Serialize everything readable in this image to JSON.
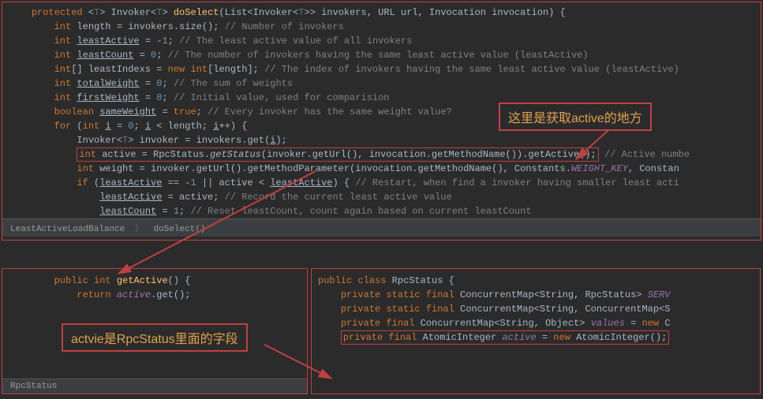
{
  "top": {
    "lines": [
      {
        "indent": 1,
        "segs": [
          {
            "t": "protected ",
            "c": "kw"
          },
          {
            "t": "<",
            "c": ""
          },
          {
            "t": "T",
            "c": "generic"
          },
          {
            "t": "> Invoker<",
            "c": ""
          },
          {
            "t": "T",
            "c": "generic"
          },
          {
            "t": "> ",
            "c": ""
          },
          {
            "t": "doSelect",
            "c": "method"
          },
          {
            "t": "(List<Invoker<",
            "c": ""
          },
          {
            "t": "T",
            "c": "generic"
          },
          {
            "t": ">> invokers, URL url, Invocation invocation) {",
            "c": ""
          }
        ]
      },
      {
        "indent": 2,
        "segs": [
          {
            "t": "int",
            "c": "kw"
          },
          {
            "t": " length = invokers.size(); ",
            "c": ""
          },
          {
            "t": "// Number of invokers",
            "c": "comment"
          }
        ]
      },
      {
        "indent": 2,
        "segs": [
          {
            "t": "int",
            "c": "kw"
          },
          {
            "t": " ",
            "c": ""
          },
          {
            "t": "leastActive",
            "c": "underline"
          },
          {
            "t": " = -",
            "c": ""
          },
          {
            "t": "1",
            "c": "num"
          },
          {
            "t": "; ",
            "c": ""
          },
          {
            "t": "// The least active value of all invokers",
            "c": "comment"
          }
        ]
      },
      {
        "indent": 2,
        "segs": [
          {
            "t": "int",
            "c": "kw"
          },
          {
            "t": " ",
            "c": ""
          },
          {
            "t": "leastCount",
            "c": "underline"
          },
          {
            "t": " = ",
            "c": ""
          },
          {
            "t": "0",
            "c": "num"
          },
          {
            "t": "; ",
            "c": ""
          },
          {
            "t": "// The number of invokers having the same least active value (leastActive)",
            "c": "comment"
          }
        ]
      },
      {
        "indent": 2,
        "segs": [
          {
            "t": "int",
            "c": "kw"
          },
          {
            "t": "[] leastIndexs = ",
            "c": ""
          },
          {
            "t": "new int",
            "c": "kw"
          },
          {
            "t": "[length]; ",
            "c": ""
          },
          {
            "t": "// The index of invokers having the same least active value (leastActive)",
            "c": "comment"
          }
        ]
      },
      {
        "indent": 2,
        "segs": [
          {
            "t": "int",
            "c": "kw"
          },
          {
            "t": " ",
            "c": ""
          },
          {
            "t": "totalWeight",
            "c": "underline"
          },
          {
            "t": " = ",
            "c": ""
          },
          {
            "t": "0",
            "c": "num"
          },
          {
            "t": "; ",
            "c": ""
          },
          {
            "t": "// The sum of weights",
            "c": "comment"
          }
        ]
      },
      {
        "indent": 2,
        "segs": [
          {
            "t": "int",
            "c": "kw"
          },
          {
            "t": " ",
            "c": ""
          },
          {
            "t": "firstWeight",
            "c": "underline"
          },
          {
            "t": " = ",
            "c": ""
          },
          {
            "t": "0",
            "c": "num"
          },
          {
            "t": "; ",
            "c": ""
          },
          {
            "t": "// Initial value, used for comparision",
            "c": "comment"
          }
        ]
      },
      {
        "indent": 2,
        "segs": [
          {
            "t": "boolean",
            "c": "kw"
          },
          {
            "t": " ",
            "c": ""
          },
          {
            "t": "sameWeight",
            "c": "underline"
          },
          {
            "t": " = ",
            "c": ""
          },
          {
            "t": "true",
            "c": "kw"
          },
          {
            "t": "; ",
            "c": ""
          },
          {
            "t": "// Every invoker has the same weight value?",
            "c": "comment"
          }
        ]
      },
      {
        "indent": 2,
        "segs": [
          {
            "t": "for ",
            "c": "kw"
          },
          {
            "t": "(",
            "c": ""
          },
          {
            "t": "int",
            "c": "kw"
          },
          {
            "t": " ",
            "c": ""
          },
          {
            "t": "i",
            "c": "underline"
          },
          {
            "t": " = ",
            "c": ""
          },
          {
            "t": "0",
            "c": "num"
          },
          {
            "t": "; ",
            "c": ""
          },
          {
            "t": "i",
            "c": "underline"
          },
          {
            "t": " < length; ",
            "c": ""
          },
          {
            "t": "i",
            "c": "underline"
          },
          {
            "t": "++) {",
            "c": ""
          }
        ]
      },
      {
        "indent": 3,
        "segs": [
          {
            "t": "Invoker<",
            "c": ""
          },
          {
            "t": "T",
            "c": "generic"
          },
          {
            "t": "> invoker = invokers.get(",
            "c": ""
          },
          {
            "t": "i",
            "c": "underline"
          },
          {
            "t": ");",
            "c": ""
          }
        ]
      },
      {
        "indent": 3,
        "boxed": true,
        "segs": [
          {
            "t": "int",
            "c": "kw"
          },
          {
            "t": " active = RpcStatus.",
            "c": ""
          },
          {
            "t": "getStatus",
            "c": "ital"
          },
          {
            "t": "(invoker.getUrl(), invocation.getMethodName()).getActive();",
            "c": ""
          }
        ],
        "tail": [
          {
            "t": " // Active numbe",
            "c": "comment"
          }
        ]
      },
      {
        "indent": 3,
        "segs": [
          {
            "t": "int",
            "c": "kw"
          },
          {
            "t": " weight = invoker.getUrl().getMethodParameter(invocation.getMethodName(), Constants.",
            "c": ""
          },
          {
            "t": "WEIGHT_KEY",
            "c": "field"
          },
          {
            "t": ", Constan",
            "c": ""
          }
        ]
      },
      {
        "indent": 3,
        "segs": [
          {
            "t": "if ",
            "c": "kw"
          },
          {
            "t": "(",
            "c": ""
          },
          {
            "t": "leastActive",
            "c": "underline"
          },
          {
            "t": " == -",
            "c": ""
          },
          {
            "t": "1",
            "c": "num"
          },
          {
            "t": " || active < ",
            "c": ""
          },
          {
            "t": "leastActive",
            "c": "underline"
          },
          {
            "t": ") { ",
            "c": ""
          },
          {
            "t": "// Restart, when find a invoker having smaller least acti",
            "c": "comment"
          }
        ]
      },
      {
        "indent": 4,
        "segs": [
          {
            "t": "leastActive",
            "c": "underline"
          },
          {
            "t": " = active; ",
            "c": ""
          },
          {
            "t": "// Record the current least active value",
            "c": "comment"
          }
        ]
      },
      {
        "indent": 4,
        "segs": [
          {
            "t": "leastCount",
            "c": "underline"
          },
          {
            "t": " = ",
            "c": ""
          },
          {
            "t": "1",
            "c": "num"
          },
          {
            "t": "; ",
            "c": ""
          },
          {
            "t": "// Reset leastCount, count again based on current leastCount",
            "c": "comment"
          }
        ]
      }
    ],
    "breadcrumb": {
      "a": "LeastActiveLoadBalance",
      "b": "doSelect()"
    }
  },
  "bottomLeft": {
    "lines": [
      {
        "indent": 2,
        "segs": [
          {
            "t": "public int ",
            "c": "kw"
          },
          {
            "t": "getActive",
            "c": "method"
          },
          {
            "t": "() {",
            "c": ""
          }
        ]
      },
      {
        "indent": 3,
        "segs": [
          {
            "t": "return ",
            "c": "kw"
          },
          {
            "t": "active",
            "c": "field"
          },
          {
            "t": ".get();",
            "c": ""
          }
        ]
      }
    ],
    "breadcrumb": "RpcStatus"
  },
  "bottomRight": {
    "lines": [
      {
        "indent": 0,
        "segs": [
          {
            "t": "public class ",
            "c": "kw"
          },
          {
            "t": "RpcStatus {",
            "c": ""
          }
        ]
      },
      {
        "indent": 0,
        "segs": [
          {
            "t": "",
            "c": ""
          }
        ]
      },
      {
        "indent": 1,
        "segs": [
          {
            "t": "private static final ",
            "c": "kw"
          },
          {
            "t": "ConcurrentMap<String, RpcStatus> ",
            "c": ""
          },
          {
            "t": "SERV",
            "c": "field"
          }
        ]
      },
      {
        "indent": 0,
        "segs": [
          {
            "t": "",
            "c": ""
          }
        ]
      },
      {
        "indent": 1,
        "segs": [
          {
            "t": "private static final ",
            "c": "kw"
          },
          {
            "t": "ConcurrentMap<String, ConcurrentMap<S",
            "c": ""
          }
        ]
      },
      {
        "indent": 1,
        "segs": [
          {
            "t": "private final ",
            "c": "kw"
          },
          {
            "t": "ConcurrentMap<String, Object> ",
            "c": ""
          },
          {
            "t": "values",
            "c": "field"
          },
          {
            "t": " = ",
            "c": ""
          },
          {
            "t": "new ",
            "c": "kw"
          },
          {
            "t": "C",
            "c": ""
          }
        ]
      },
      {
        "indent": 1,
        "boxed": true,
        "segs": [
          {
            "t": "private final ",
            "c": "kw"
          },
          {
            "t": "AtomicInteger ",
            "c": ""
          },
          {
            "t": "active",
            "c": "field"
          },
          {
            "t": " = ",
            "c": ""
          },
          {
            "t": "new ",
            "c": "kw"
          },
          {
            "t": "AtomicInteger();",
            "c": ""
          }
        ]
      }
    ]
  },
  "annotations": {
    "a1": "这里是获取active的地方",
    "a2": "actvie是RpcStatus里面的字段"
  }
}
